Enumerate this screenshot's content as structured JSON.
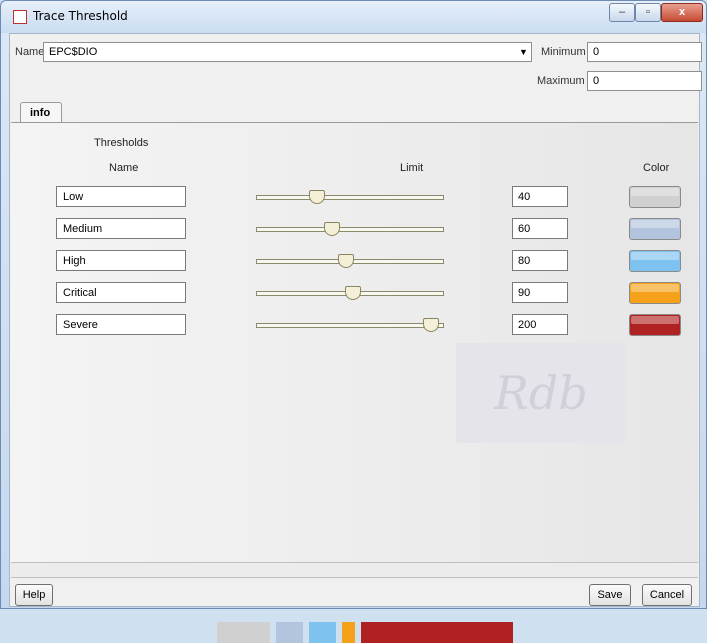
{
  "window": {
    "title": "Trace Threshold",
    "controls": {
      "minimize": "–",
      "maximize": "▫",
      "close": "x"
    }
  },
  "form": {
    "name_label": "Name",
    "name_value": "EPC$DIO",
    "minimum_label": "Minimum",
    "minimum_value": "0",
    "maximum_label": "Maximum",
    "maximum_value": "0"
  },
  "tabs": [
    {
      "label": "info"
    }
  ],
  "thresholds": {
    "section_title": "Thresholds",
    "col_name": "Name",
    "col_limit": "Limit",
    "col_color": "Color",
    "slider_max": 200,
    "rows": [
      {
        "name": "Low",
        "limit": "40",
        "slider": 40,
        "color": "#d0d0d0"
      },
      {
        "name": "Medium",
        "limit": "60",
        "slider": 60,
        "color": "#b2c4de"
      },
      {
        "name": "High",
        "limit": "80",
        "slider": 80,
        "color": "#7ec2f0"
      },
      {
        "name": "Critical",
        "limit": "90",
        "slider": 90,
        "color": "#f5a21a"
      },
      {
        "name": "Severe",
        "limit": "200",
        "slider": 200,
        "color": "#b02222"
      }
    ]
  },
  "color_bar": [
    {
      "color": "#d0d0d0",
      "share": 40
    },
    {
      "color": "#b2c4de",
      "share": 20
    },
    {
      "color": "#7ec2f0",
      "share": 20
    },
    {
      "color": "#f5a21a",
      "share": 10
    },
    {
      "color": "#b02222",
      "share": 110
    }
  ],
  "watermark": "Rdb",
  "buttons": {
    "help": "Help",
    "save": "Save",
    "cancel": "Cancel"
  }
}
